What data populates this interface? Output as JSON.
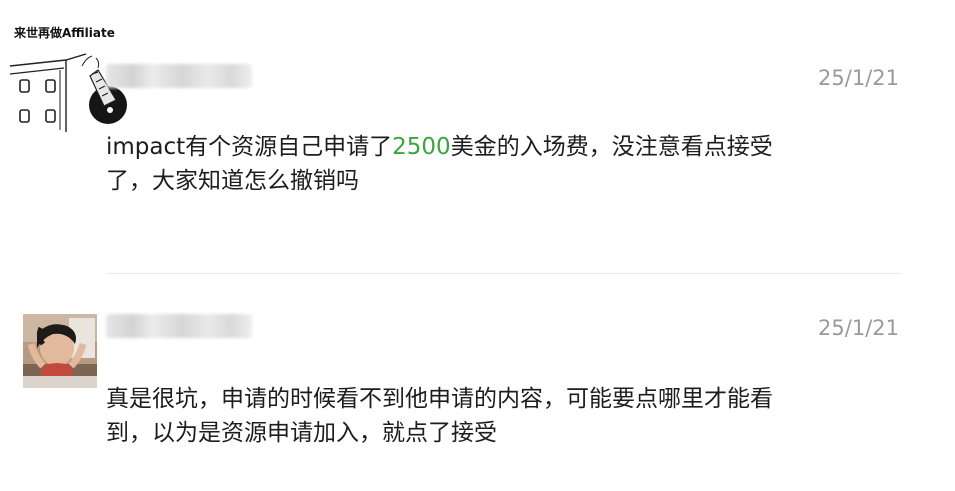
{
  "watermark": "来世再做Affiliate",
  "posts": [
    {
      "date": "25/1/21",
      "text_before": "impact有个资源自己申请了",
      "highlight": "2500",
      "text_after": "美金的入场费，没注意看点接受了，大家知道怎么撤销吗"
    },
    {
      "date": "25/1/21",
      "text": "真是很坑，申请的时候看不到他申请的内容，可能要点哪里才能看到，以为是资源申请加入，就点了接受"
    }
  ],
  "colors": {
    "highlight": "#3aa53a",
    "date": "#9a9a9a",
    "divider": "#ececec"
  },
  "icons": {
    "avatar1": "sketch-building-avatar",
    "avatar2": "photo-avatar"
  }
}
